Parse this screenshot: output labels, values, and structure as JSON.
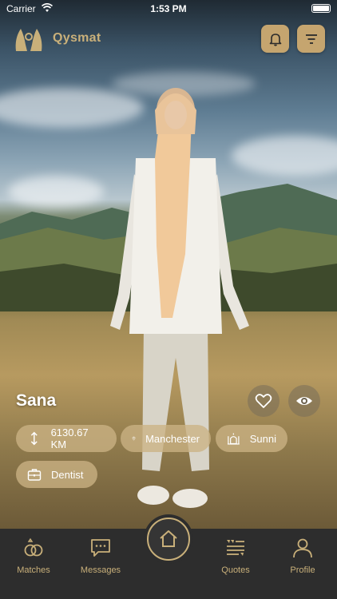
{
  "status": {
    "carrier": "Carrier",
    "time": "1:53 PM"
  },
  "header": {
    "brand": "Qysmat",
    "icons": [
      "bell-icon",
      "filter-icon"
    ]
  },
  "profile": {
    "name": "Sana",
    "chips": {
      "distance": "6130.67 KM",
      "location": "Manchester",
      "sect": "Sunni",
      "profession": "Dentist"
    }
  },
  "tabbar": {
    "items": [
      {
        "label": "Matches",
        "icon": "rings-icon"
      },
      {
        "label": "Messages",
        "icon": "messages-icon"
      },
      {
        "label": "",
        "icon": "home-icon"
      },
      {
        "label": "Quotes",
        "icon": "quotes-icon"
      },
      {
        "label": "Profile",
        "icon": "profile-icon"
      }
    ]
  },
  "colors": {
    "accent": "#c9b07a",
    "button": "#c5a56f",
    "tabbar": "#2d2d2d"
  }
}
